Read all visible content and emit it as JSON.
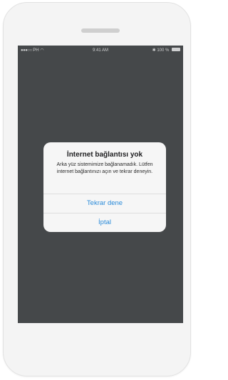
{
  "status_bar": {
    "carrier": "PH",
    "time": "9:41 AM",
    "battery": "100 %"
  },
  "dialog": {
    "title": "İnternet bağlantısı yok",
    "message": "Arka yüz sistemimize bağlanamadık. Lütfen internet bağlantınızı açın ve tekrar deneyin.",
    "retry_label": "Tekrar dene",
    "cancel_label": "İptal"
  },
  "colors": {
    "screen_overlay": "#45484a",
    "dialog_bg": "#f6f6f6",
    "button_text": "#2b8bd9"
  }
}
